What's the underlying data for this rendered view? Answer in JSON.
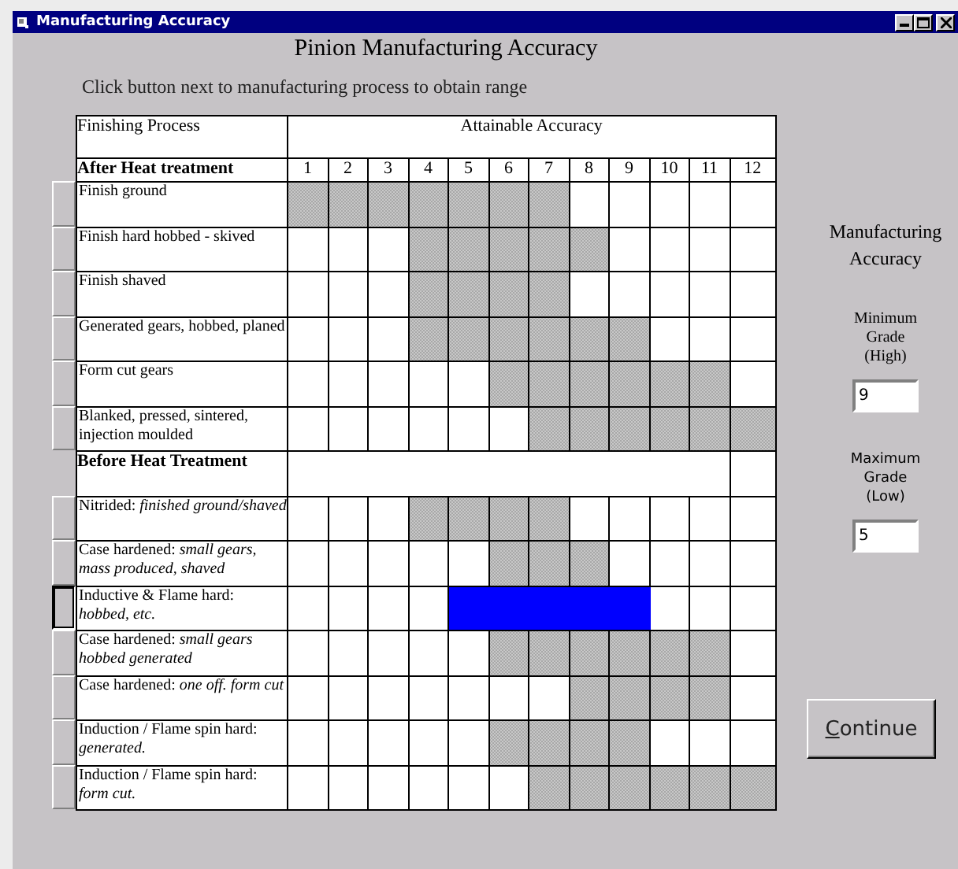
{
  "window": {
    "title": "Manufacturing Accuracy"
  },
  "heading": "Pinion Manufacturing Accuracy",
  "instruction": "Click button next to manufacturing process to obtain range",
  "table": {
    "process_header": "Finishing Process",
    "accuracy_header": "Attainable Accuracy",
    "grades": [
      "1",
      "2",
      "3",
      "4",
      "5",
      "6",
      "7",
      "8",
      "9",
      "10",
      "11",
      "12"
    ],
    "sections": [
      {
        "title": "After Heat treatment",
        "rows": [
          {
            "process": "Finish ground",
            "selected": false,
            "shaded": [
              true,
              true,
              true,
              true,
              true,
              true,
              true,
              false,
              false,
              false,
              false,
              false
            ]
          },
          {
            "process": "Finish hard hobbed - skived",
            "selected": false,
            "shaded": [
              false,
              false,
              false,
              true,
              true,
              true,
              true,
              true,
              false,
              false,
              false,
              false
            ]
          },
          {
            "process": "Finish shaved",
            "selected": false,
            "shaded": [
              false,
              false,
              false,
              true,
              true,
              true,
              true,
              false,
              false,
              false,
              false,
              false
            ]
          },
          {
            "process": "Generated gears, hobbed, planed",
            "selected": false,
            "shaded": [
              false,
              false,
              false,
              true,
              true,
              true,
              true,
              true,
              true,
              false,
              false,
              false
            ]
          },
          {
            "process": "Form cut gears",
            "selected": false,
            "shaded": [
              false,
              false,
              false,
              false,
              false,
              true,
              true,
              true,
              true,
              true,
              true,
              false
            ]
          },
          {
            "process": "Blanked, pressed, sintered, injection moulded",
            "selected": false,
            "shaded": [
              false,
              false,
              false,
              false,
              false,
              false,
              true,
              true,
              true,
              true,
              true,
              true
            ]
          }
        ]
      },
      {
        "title": "Before Heat Treatment",
        "rows": [
          {
            "process": "Nitrided: *finished ground/shaved*",
            "selected": false,
            "shaded": [
              false,
              false,
              false,
              true,
              true,
              true,
              true,
              false,
              false,
              false,
              false,
              false
            ]
          },
          {
            "process": "Case hardened: *small gears, mass produced, shaved*",
            "selected": false,
            "shaded": [
              false,
              false,
              false,
              false,
              false,
              true,
              true,
              true,
              false,
              false,
              false,
              false
            ]
          },
          {
            "process": "Inductive & Flame hard: *hobbed, etc.*",
            "selected": true,
            "shaded": [
              false,
              false,
              false,
              false,
              true,
              true,
              true,
              true,
              true,
              false,
              false,
              false
            ]
          },
          {
            "process": "Case hardened: *small gears hobbed generated*",
            "selected": false,
            "shaded": [
              false,
              false,
              false,
              false,
              false,
              true,
              true,
              true,
              true,
              true,
              true,
              false
            ]
          },
          {
            "process": "Case hardened: *one off. form cut*",
            "selected": false,
            "shaded": [
              false,
              false,
              false,
              false,
              false,
              false,
              false,
              true,
              true,
              true,
              true,
              false
            ]
          },
          {
            "process": "Induction / Flame spin hard: *generated.*",
            "selected": false,
            "shaded": [
              false,
              false,
              false,
              false,
              false,
              true,
              true,
              true,
              true,
              false,
              false,
              false
            ]
          },
          {
            "process": "Induction / Flame spin hard: *form cut.*",
            "selected": false,
            "shaded": [
              false,
              false,
              false,
              false,
              false,
              false,
              true,
              true,
              true,
              true,
              true,
              true
            ]
          }
        ]
      }
    ]
  },
  "panel": {
    "title": "Manufacturing Accuracy",
    "fields": [
      {
        "label": "Minimum Grade (High)",
        "value": "9"
      },
      {
        "label": "Maximum Grade (Low)",
        "value": "5"
      }
    ]
  },
  "continue_button": "Continue"
}
